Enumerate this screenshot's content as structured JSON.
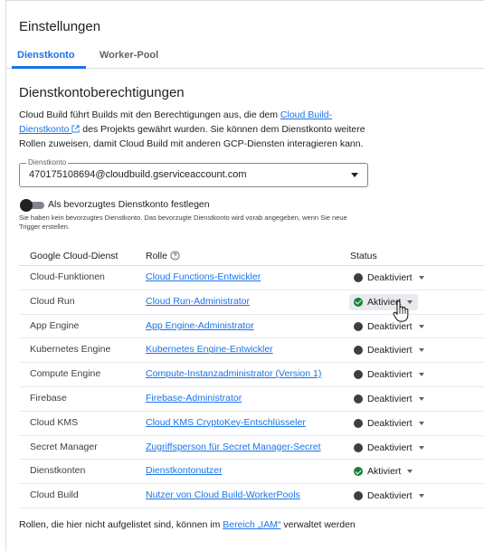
{
  "header": {
    "title": "Einstellungen"
  },
  "tabs": [
    {
      "label": "Dienstkonto",
      "active": true
    },
    {
      "label": "Worker-Pool",
      "active": false
    }
  ],
  "section": {
    "title": "Dienstkontoberechtigungen",
    "desc_part1": "Cloud Build führt Builds mit den Berechtigungen aus, die dem ",
    "desc_link": "Cloud Build-Dienstkonto",
    "desc_part2": " des Projekts gewährt wurden. Sie können dem Dienstkonto weitere Rollen zuweisen, damit Cloud Build mit anderen GCP-Diensten interagieren kann."
  },
  "select": {
    "label": "Dienstkonto",
    "value": "470175108694@cloudbuild.gserviceaccount.com"
  },
  "toggle": {
    "label": "Als bevorzugtes Dienstkonto festlegen",
    "help": "Sie haben kein bevorzugtes Dienstkonto. Das bevorzugte Dienstkonto wird vorab angegeben, wenn Sie neue Trigger erstellen.",
    "on": false
  },
  "table": {
    "headers": {
      "service": "Google Cloud-Dienst",
      "role": "Rolle",
      "status": "Status"
    },
    "rows": [
      {
        "service": "Cloud-Funktionen",
        "role": "Cloud Functions-Entwickler",
        "status": "Deaktiviert",
        "enabled": false
      },
      {
        "service": "Cloud Run",
        "role": "Cloud Run-Administrator",
        "status": "Aktiviert",
        "enabled": true
      },
      {
        "service": "App Engine",
        "role": "App Engine-Administrator",
        "status": "Deaktiviert",
        "enabled": false
      },
      {
        "service": "Kubernetes Engine",
        "role": "Kubernetes Engine-Entwickler",
        "status": "Deaktiviert",
        "enabled": false
      },
      {
        "service": "Compute Engine",
        "role": "Compute-Instanzadministrator (Version 1)",
        "status": "Deaktiviert",
        "enabled": false
      },
      {
        "service": "Firebase",
        "role": "Firebase-Administrator",
        "status": "Deaktiviert",
        "enabled": false
      },
      {
        "service": "Cloud KMS",
        "role": "Cloud KMS CryptoKey-Entschlüsseler",
        "status": "Deaktiviert",
        "enabled": false
      },
      {
        "service": "Secret Manager",
        "role": "Zugriffsperson für Secret Manager-Secret",
        "status": "Deaktiviert",
        "enabled": false
      },
      {
        "service": "Dienstkonten",
        "role": "Dienstkontonutzer",
        "status": "Aktiviert",
        "enabled": true
      },
      {
        "service": "Cloud Build",
        "role": "Nutzer von Cloud Build-WorkerPools",
        "status": "Deaktiviert",
        "enabled": false
      }
    ]
  },
  "footer": {
    "text_before": "Rollen, die hier nicht aufgelistet sind, können im ",
    "link": "Bereich „IAM“",
    "text_after": " verwaltet werden"
  },
  "colors": {
    "accent": "#1a73e8",
    "enabled": "#188038",
    "disabled": "#3c4043"
  },
  "icons": [
    "external-link-icon",
    "help-icon",
    "chevron-down-icon",
    "check-circle-icon",
    "hand-cursor-icon"
  ]
}
